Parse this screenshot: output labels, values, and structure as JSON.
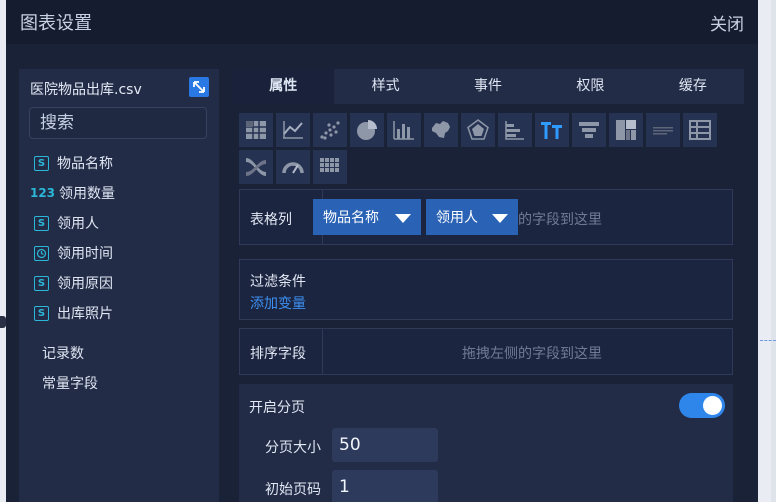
{
  "dialog": {
    "title": "图表设置",
    "close_label": "关闭"
  },
  "left": {
    "file_name": "医院物品出库.csv",
    "search_placeholder": "搜索",
    "fields": [
      {
        "icon": "S",
        "label": "物品名称"
      },
      {
        "icon": "123",
        "label": "领用数量"
      },
      {
        "icon": "S",
        "label": "领用人"
      },
      {
        "icon": "clock",
        "label": "领用时间"
      },
      {
        "icon": "S",
        "label": "领用原因"
      },
      {
        "icon": "S",
        "label": "出库照片"
      }
    ],
    "record_count_label": "记录数",
    "constant_field_label": "常量字段"
  },
  "tabs": [
    "属性",
    "样式",
    "事件",
    "权限",
    "缓存"
  ],
  "chart_types": [
    "table-chart",
    "line-chart",
    "scatter-chart",
    "pie-chart",
    "bar-chart",
    "china-map",
    "radar-chart",
    "horizontal-bar-chart",
    "text-chart",
    "funnel-chart",
    "treemap-chart",
    "progress-chart",
    "pivot-table",
    "sankey-chart",
    "gauge-chart",
    "heatmap-chart"
  ],
  "columns_section": {
    "label": "表格列",
    "chips": [
      "物品名称",
      "领用人"
    ],
    "hint": "的字段到这里"
  },
  "filter_section": {
    "label": "过滤条件",
    "add_variable": "添加变量"
  },
  "sort_section": {
    "label": "排序字段",
    "hint": "拖拽左侧的字段到这里"
  },
  "pagination": {
    "label": "开启分页",
    "enabled": true,
    "page_size_label": "分页大小",
    "page_size": "50",
    "initial_page_label": "初始页码",
    "initial_page": "1"
  },
  "colors": {
    "accent": "#2f86ea",
    "chip": "#2a63b5",
    "field_icon": "#2bb7d7",
    "link": "#3d8ff0"
  }
}
